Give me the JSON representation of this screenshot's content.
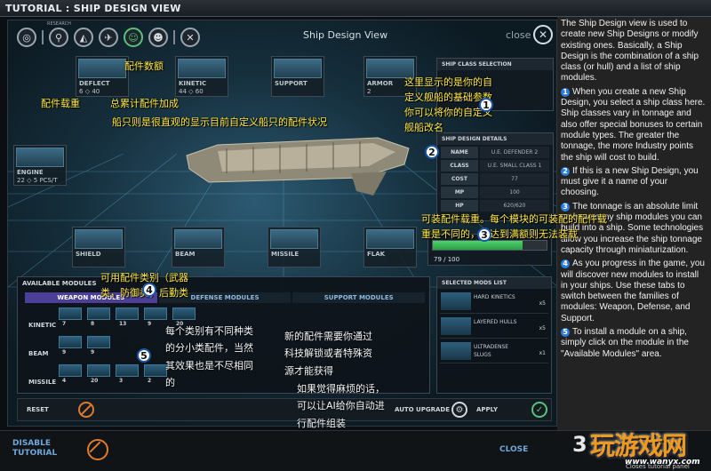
{
  "window_title": "TUTORIAL : SHIP DESIGN VIEW",
  "research_label": "RESEARCH",
  "view_title": "Ship Design View",
  "close_label": "close",
  "colors": {
    "accent_green": "#59c27a",
    "accent_orange": "#e07a2d",
    "badge_blue": "#2a7ee0",
    "annotation_yellow": "#ffe845",
    "watermark_orange": "#f09a1a"
  },
  "slots": {
    "deflect": {
      "name": "DEFLECT",
      "count_a": "6",
      "count_b": "40"
    },
    "kinetic": {
      "name": "KINETIC",
      "count_a": "44",
      "count_b": "60"
    },
    "support": {
      "name": "SUPPORT"
    },
    "armor": {
      "name": "ARMOR",
      "count_a": "2"
    },
    "engine": {
      "name": "ENGINE",
      "count_a": "22",
      "count_b": "5 PCS/T"
    },
    "shield": {
      "name": "SHIELD"
    },
    "beam": {
      "name": "BEAM"
    },
    "missile": {
      "name": "MISSILE"
    },
    "flak": {
      "name": "FLAK"
    }
  },
  "ship_class_selection": {
    "header": "SHIP CLASS SELECTION"
  },
  "ship_details": {
    "header": "SHIP DESIGN DETAILS",
    "rows": [
      {
        "key": "NAME",
        "value": "U.E. DEFENDER 2"
      },
      {
        "key": "CLASS",
        "value": "U.E. SMALL CLASS 1"
      },
      {
        "key": "COST",
        "value": "77"
      },
      {
        "key": "MP",
        "value": "100"
      },
      {
        "key": "HP",
        "value": "620/620"
      }
    ]
  },
  "tonnage": {
    "text": "79 / 100",
    "fill": 0.79
  },
  "available_modules": {
    "header": "AVAILABLE MODULES",
    "tabs": [
      "WEAPON MODULES",
      "DEFENSE MODULES",
      "SUPPORT MODULES"
    ],
    "rows": [
      {
        "label": "KINETIC",
        "mods": [
          "7",
          "8",
          "13",
          "9",
          "20"
        ]
      },
      {
        "label": "BEAM",
        "mods": [
          "9",
          "9"
        ]
      },
      {
        "label": "MISSILE",
        "mods": [
          "4",
          "20",
          "3",
          "2"
        ]
      }
    ]
  },
  "selected_modules": {
    "header": "SELECTED MODS LIST",
    "items": [
      {
        "name": "HARD KINETICS",
        "qty": "x5"
      },
      {
        "name": "LAYERED HULLS",
        "qty": "x5"
      },
      {
        "name": "ULTRADENSE SLUGS",
        "qty": "x1"
      }
    ]
  },
  "bottom_bar": {
    "reset": "RESET",
    "auto_upgrade": "AUTO UPGRADE",
    "apply": "APPLY"
  },
  "annotations": {
    "slot_count": "配件数额",
    "slot_load": "配件载重",
    "total_bonus": "总累计配件加成",
    "ship_note": "船只则是很直观的显示目前自定义船只的配件状况",
    "class_note_1": "这里显示的是你的自",
    "class_note_2": "定义舰船的基础参数",
    "class_note_3": "你可以将你的自定义",
    "class_note_4": "舰船改名",
    "tonnage_note_1": "可装配件载重。每个模块的可装配的配件载",
    "tonnage_note_2": "重是不同的，当达到满额则无法装载",
    "categories_note_1": "可用配件类别（武器",
    "categories_note_2": "类，防御类，后勤类",
    "subtype_note_1": "每个类别有不同种类",
    "subtype_note_2": "的分小类配件，当然",
    "subtype_note_3": "其效果也是不尽相同",
    "subtype_note_4": "的",
    "research_note_1": "新的配件需要你通过",
    "research_note_2": "科技解锁或者特殊资",
    "research_note_3": "源才能获得",
    "auto_note_1": "如果觉得麻烦的话，",
    "auto_note_2": "可以让AI给你自动进",
    "auto_note_3": "行配件组装",
    "badges": [
      "1",
      "2",
      "3",
      "4",
      "5"
    ]
  },
  "tutorial_text": {
    "intro": "The Ship Design view is used to create new Ship Designs or modify existing ones. Basically, a Ship Design is the combination of a ship class (or hull) and a list of ship modules.",
    "steps": [
      {
        "n": "1",
        "text": "When you create a new Ship Design, you select a ship class here. Ship classes vary in tonnage and also offer special bonuses to certain module types. The greater the tonnage, the more Industry points the ship will cost to build."
      },
      {
        "n": "2",
        "text": "If this is a new Ship Design, you must give it a name of your choosing."
      },
      {
        "n": "3",
        "text": "The tonnage is an absolute limit on how many ship modules you can build into a ship. Some technologies allow you increase the ship tonnage capacity through miniaturization."
      },
      {
        "n": "4",
        "text": "As you progress in the game, you will discover new modules to install in your ships. Use these tabs to switch between the families of modules: Weapon, Defense, and Support."
      },
      {
        "n": "5",
        "text": "To install a module on a ship, simply click on the module in the \"Available Modules\" area."
      }
    ]
  },
  "footer": {
    "disable_1": "DISABLE",
    "disable_2": "TUTORIAL",
    "close": "CLOSE",
    "page_digit": "3",
    "tutorial_panel": "Closes tutorial panel"
  },
  "watermark": {
    "text": "玩游戏网",
    "url": "www.wanyx.com"
  }
}
